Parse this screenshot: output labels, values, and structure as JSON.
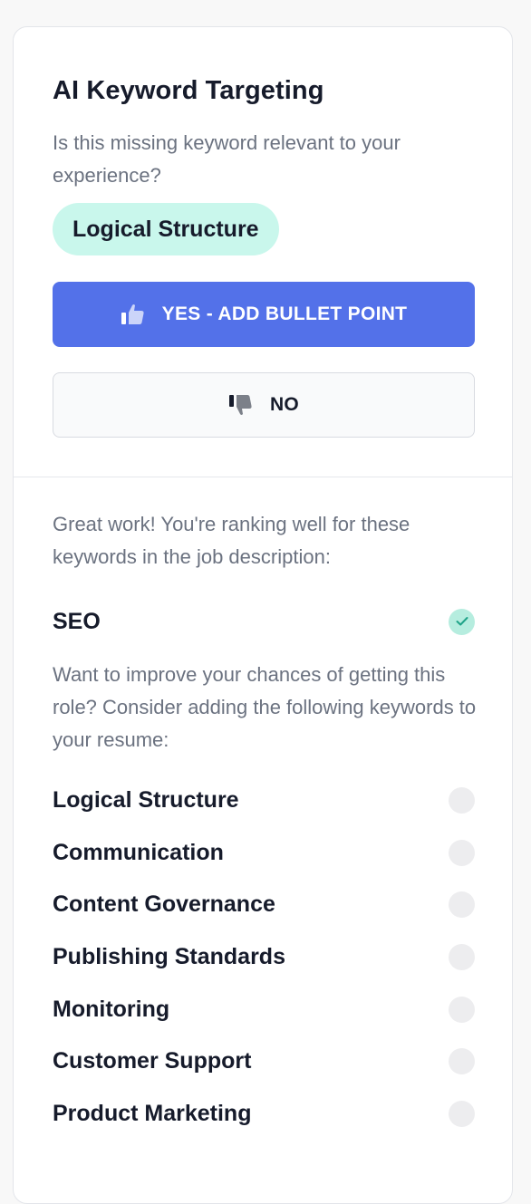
{
  "card": {
    "title": "AI Keyword Targeting",
    "question": "Is this missing keyword relevant to your experience?",
    "suggested_keyword": "Logical Structure",
    "yes_label": "YES - ADD BULLET POINT",
    "no_label": "NO"
  },
  "ranking": {
    "message": "Great work! You're ranking well for these keywords in the job description:",
    "keywords": [
      {
        "label": "SEO",
        "status": "matched"
      }
    ]
  },
  "missing": {
    "message": "Want to improve your chances of getting this role? Consider adding the following keywords to your resume:",
    "keywords": [
      {
        "label": "Logical Structure",
        "status": "missing"
      },
      {
        "label": "Communication",
        "status": "missing"
      },
      {
        "label": "Content Governance",
        "status": "missing"
      },
      {
        "label": "Publishing Standards",
        "status": "missing"
      },
      {
        "label": "Monitoring",
        "status": "missing"
      },
      {
        "label": "Customer Support",
        "status": "missing"
      },
      {
        "label": "Product Marketing",
        "status": "missing"
      }
    ]
  },
  "icons": {
    "yes": "thumbs-up-icon",
    "no": "thumbs-down-icon",
    "matched": "check-icon"
  },
  "colors": {
    "primary": "#5371e9",
    "chip_bg": "#c9f7ec",
    "matched_bg": "#b6eddf",
    "check": "#1fa388",
    "pending_bg": "#ededef"
  }
}
